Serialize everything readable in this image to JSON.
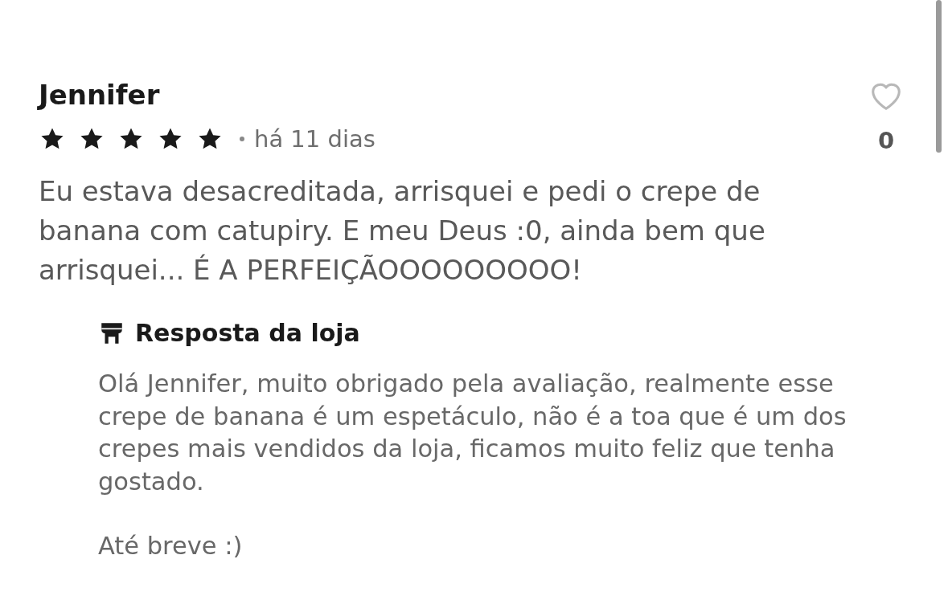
{
  "review": {
    "author": "Jennifer",
    "stars": 5,
    "time": "há 11 dias",
    "liked": false,
    "like_count": "0",
    "text": "Eu estava desacreditada, arrisquei e pedi o crepe de banana com catupiry. E meu Deus :0, ainda bem que arrisquei... É A PERFEIÇÃOOOOOOOOO!",
    "reply": {
      "title": "Resposta da loja",
      "paragraphs": [
        "Olá Jennifer, muito obrigado pela avaliação, realmente esse crepe de banana é um espetáculo, não é a toa que é um dos crepes mais vendidos da loja, ficamos muito feliz que tenha gostado.",
        "Até breve :)"
      ]
    }
  }
}
